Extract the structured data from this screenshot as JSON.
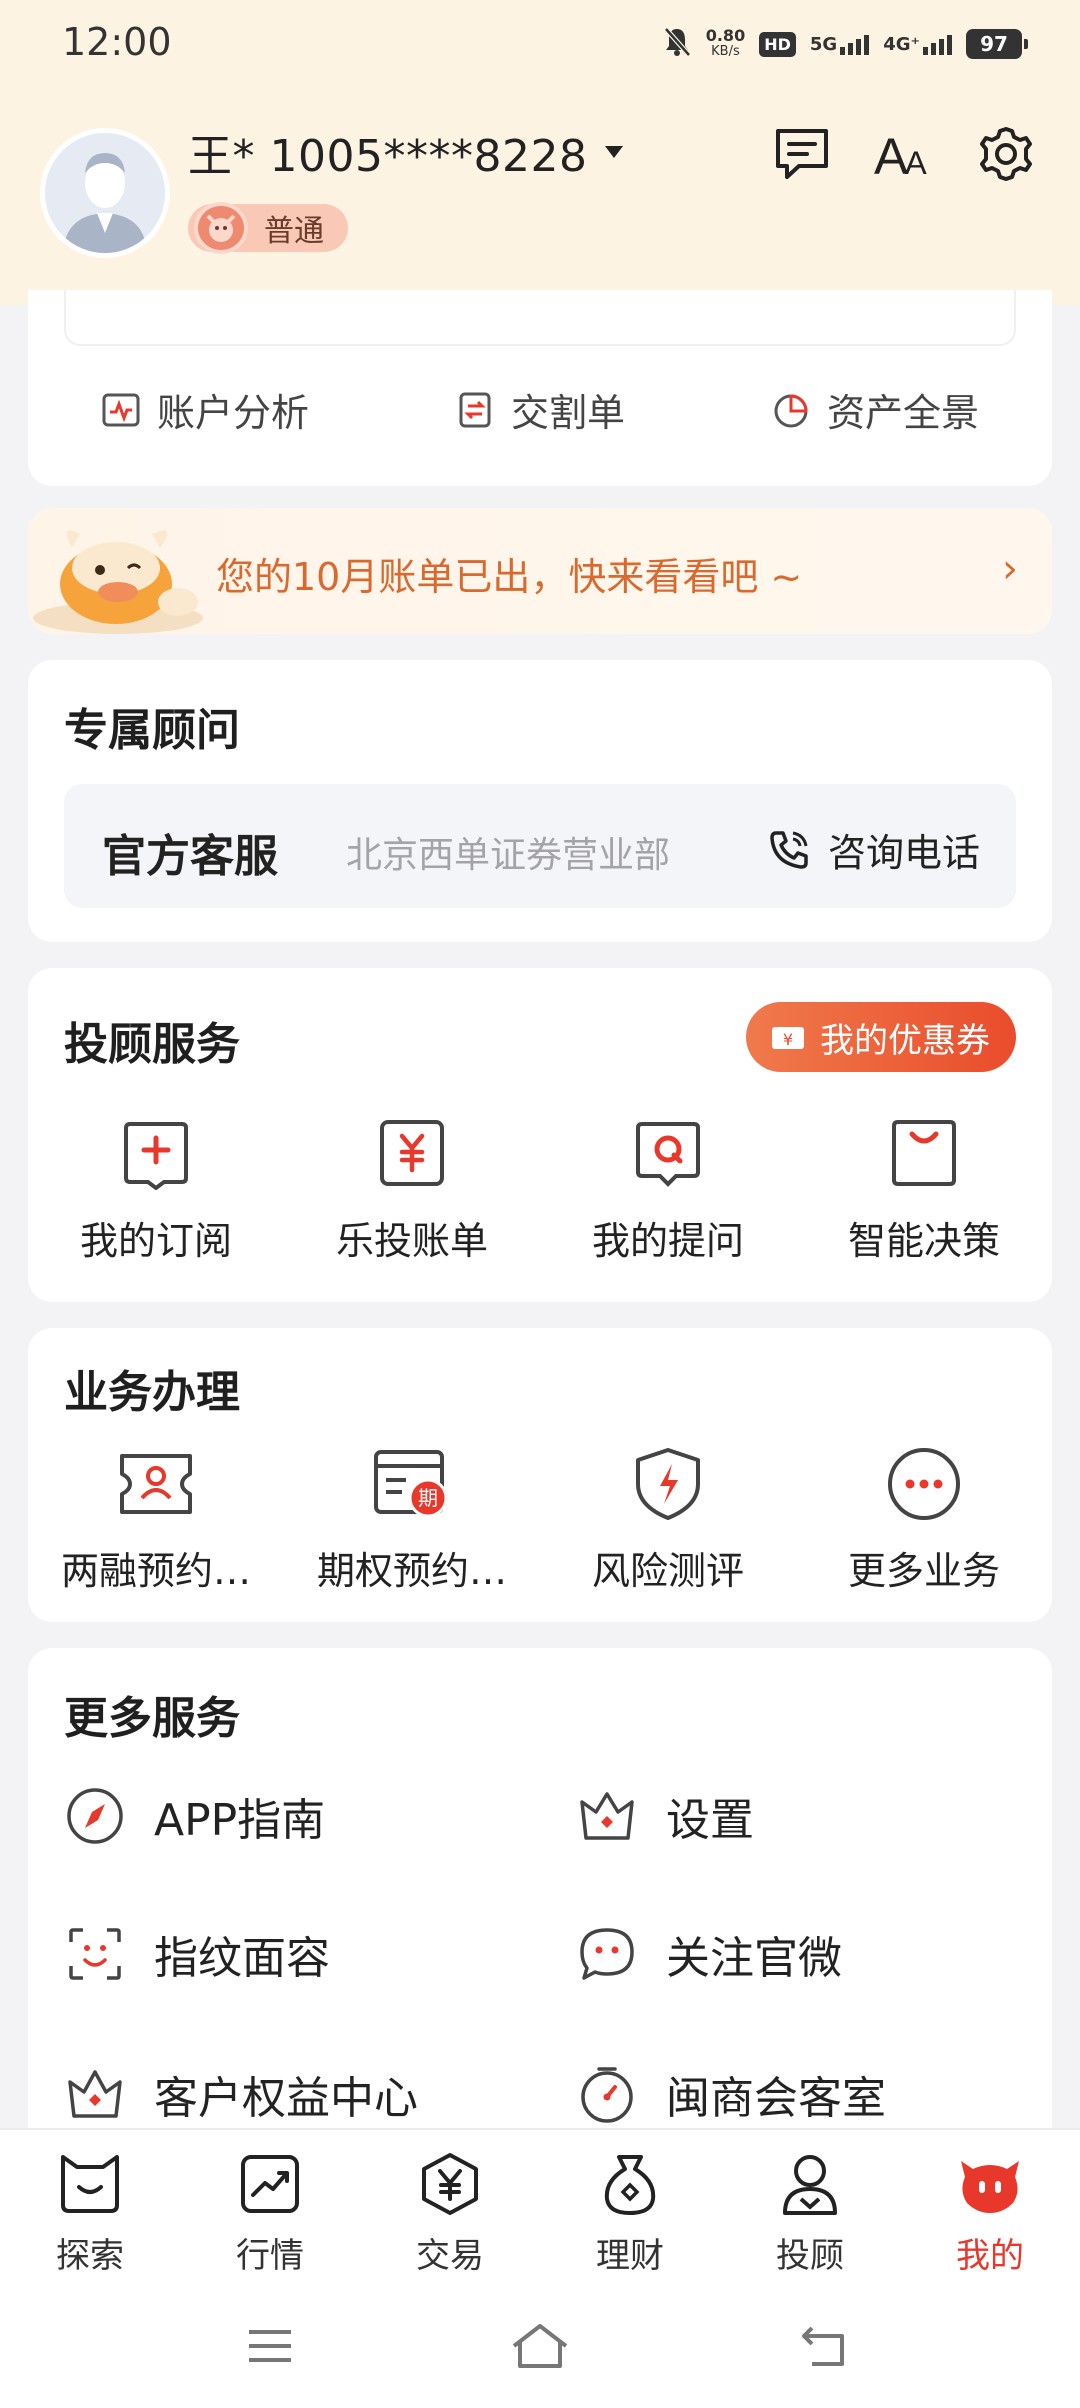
{
  "status_bar": {
    "time": "12:00",
    "net_speed_value": "0.80",
    "net_speed_unit": "KB/s",
    "hd_label": "HD",
    "net_5g": "5G",
    "net_4g": "4G⁺",
    "battery": "97"
  },
  "header": {
    "user_name": "王* 1005****8228",
    "level_badge": "普通"
  },
  "account_links": [
    {
      "label": "账户分析",
      "icon": "pulse-chart-icon"
    },
    {
      "label": "交割单",
      "icon": "exchange-doc-icon"
    },
    {
      "label": "资产全景",
      "icon": "pie-chart-icon"
    }
  ],
  "bill_banner": {
    "text": "您的10月账单已出，快来看看吧 ~",
    "chevron": "›"
  },
  "advisor": {
    "title": "专属顾问",
    "name": "官方客服",
    "branch": "北京西单证券营业部",
    "phone_label": "咨询电话"
  },
  "tougu": {
    "title": "投顾服务",
    "coupon_label": "我的优惠券",
    "items": [
      {
        "label": "我的订阅",
        "icon": "subscribe-icon"
      },
      {
        "label": "乐投账单",
        "icon": "yen-bill-icon"
      },
      {
        "label": "我的提问",
        "icon": "question-bubble-icon"
      },
      {
        "label": "智能决策",
        "icon": "smart-bag-icon"
      }
    ]
  },
  "business": {
    "title": "业务办理",
    "items": [
      {
        "label": "两融预约…",
        "icon": "margin-ticket-icon"
      },
      {
        "label": "期权预约…",
        "icon": "option-calendar-icon"
      },
      {
        "label": "风险测评",
        "icon": "risk-shield-icon"
      },
      {
        "label": "更多业务",
        "icon": "more-dots-icon"
      }
    ],
    "option_glyph": "期"
  },
  "more_services": {
    "title": "更多服务",
    "items": [
      {
        "label": "APP指南",
        "icon": "compass-icon"
      },
      {
        "label": "设置",
        "icon": "crown-settings-icon"
      },
      {
        "label": "指纹面容",
        "icon": "face-scan-icon"
      },
      {
        "label": "关注官微",
        "icon": "wechat-bubble-icon"
      },
      {
        "label": "客户权益中心",
        "icon": "crown-icon"
      },
      {
        "label": "闽商会客室",
        "icon": "stopwatch-icon"
      }
    ]
  },
  "bottom_nav": [
    {
      "label": "探索",
      "icon": "explore-icon"
    },
    {
      "label": "行情",
      "icon": "market-icon"
    },
    {
      "label": "交易",
      "icon": "trade-yen-icon"
    },
    {
      "label": "理财",
      "icon": "money-bag-icon"
    },
    {
      "label": "投顾",
      "icon": "advisor-person-icon"
    },
    {
      "label": "我的",
      "icon": "me-mascot-icon",
      "active": true
    }
  ],
  "colors": {
    "accent": "#e8382b",
    "header_bg": "#fdf3e2",
    "banner_text": "#d96a2f"
  }
}
